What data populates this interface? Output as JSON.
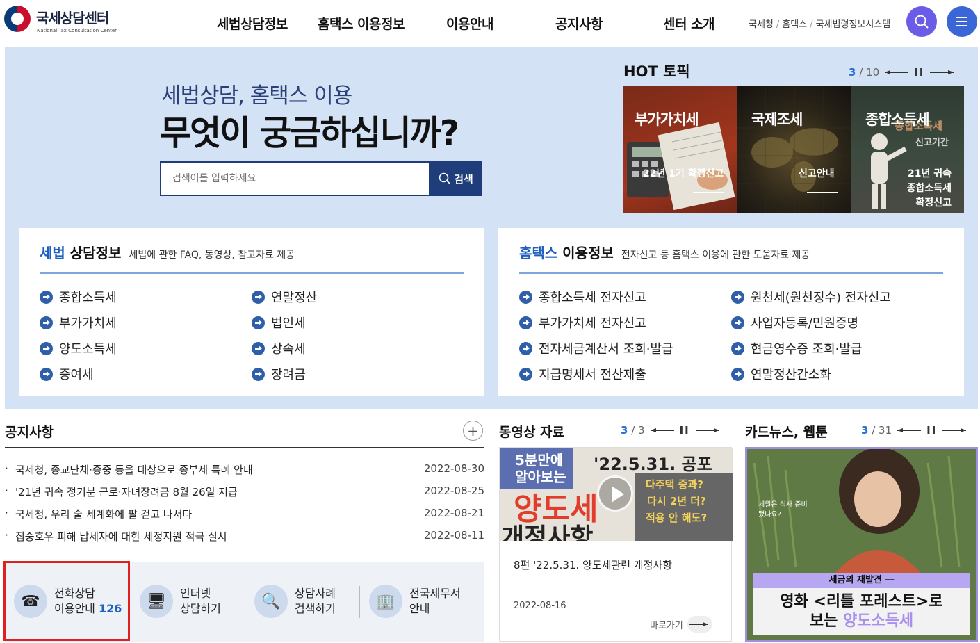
{
  "header": {
    "logo_title": "국세상담센터",
    "logo_sub": "National Tax Consultation Center",
    "nav": [
      "세법상담정보",
      "홈택스 이용정보",
      "이용안내",
      "공지사항",
      "센터 소개"
    ],
    "util_links": [
      "국세청",
      "홈택스",
      "국세법령정보시스템"
    ],
    "util_sep": "/",
    "search_icon": "search-icon",
    "menu_icon": "menu-icon",
    "colors": {
      "search_btn": "#6b5ce7",
      "menu_btn": "#3a66d8"
    }
  },
  "hero": {
    "subtitle": "세법상담, 홈택스 이용",
    "title": "무엇이 궁금하십니까?",
    "search_placeholder": "검색어를 입력하세요",
    "search_button": "검색",
    "bg_color": "#d3e2f4"
  },
  "hot_topic": {
    "title": "HOT 토픽",
    "current": "3",
    "total": "/ 10",
    "pause": "II",
    "cards": [
      {
        "title": "부가가치세",
        "sub": "22년 1기 확정신고"
      },
      {
        "title": "국제조세",
        "sub": "신고안내"
      },
      {
        "title": "종합소득세",
        "sub_lines": [
          "21년 귀속",
          "종합소득세",
          "확정신고"
        ],
        "bg_text": "종합소득세",
        "bg_text2": "신고기간"
      }
    ]
  },
  "tax_info": {
    "title_accent": "세법",
    "title_rest": " 상담정보",
    "desc": "세법에 관한 FAQ, 동영상, 참고자료 제공",
    "items": [
      "종합소득세",
      "연말정산",
      "부가가치세",
      "법인세",
      "양도소득세",
      "상속세",
      "증여세",
      "장려금"
    ]
  },
  "hometax_info": {
    "title_accent": "홈택스",
    "title_rest": " 이용정보",
    "desc": "전자신고 등 홈택스 이용에 관한 도움자료 제공",
    "items": [
      "종합소득세 전자신고",
      "원천세(원천징수) 전자신고",
      "부가가치세 전자신고",
      "사업자등록/민원증명",
      "전자세금계산서 조회·발급",
      "현금영수증 조회·발급",
      "지급명세서 전산제출",
      "연말정산간소화"
    ]
  },
  "notices": {
    "title": "공지사항",
    "more": "+",
    "bullet": "·",
    "rows": [
      {
        "title": "국세청, 종교단체·종중 등을 대상으로 종부세 특례 안내",
        "date": "2022-08-30"
      },
      {
        "title": "'21년 귀속 정기분 근로·자녀장려금 8월 26일 지급",
        "date": "2022-08-25"
      },
      {
        "title": "국세청, 우리 술 세계화에 팔 걷고 나서다",
        "date": "2022-08-21"
      },
      {
        "title": "집중호우 피해 납세자에 대한 세정지원 적극 실시",
        "date": "2022-08-11"
      }
    ]
  },
  "quick_links": [
    {
      "line1": "전화상담",
      "line2": "이용안내",
      "num": "126",
      "icon": "phone-icon",
      "glyph": "☎"
    },
    {
      "line1": "인터넷",
      "line2": "상담하기",
      "icon": "monitor-icon",
      "glyph": "🖥"
    },
    {
      "line1": "상담사례",
      "line2": "검색하기",
      "icon": "magnifier-icon",
      "glyph": "🔍"
    },
    {
      "line1": "전국세무서",
      "line2": "안내",
      "icon": "building-icon",
      "glyph": "🏢"
    }
  ],
  "videos": {
    "title": "동영상 자료",
    "current": "3",
    "total": "/ 3",
    "pause": "II",
    "thumb_text1": "5분만에",
    "thumb_text2": "알아보는",
    "thumb_text3": "양도세",
    "thumb_text4": "개정사항",
    "thumb_text5": "'22.5.31. 공포",
    "thumb_text6": "다주택 중과?",
    "thumb_text7": "다시 2년 더?",
    "thumb_text8": "적용 안 해도?",
    "item_title": "8편 '22.5.31. 양도세관련 개정사항",
    "item_date": "2022-08-16",
    "go": "바로가기"
  },
  "card_news": {
    "title": "카드뉴스, 웹툰",
    "current": "3",
    "total": "/ 31",
    "pause": "II",
    "small_text": "세월은 식사 준비 됐나요?",
    "banner": "세금의 재발견 ―",
    "headline1": "영화 <리틀 포레스트>로",
    "headline2_pre": "보는 ",
    "headline2_accent": "양도소득세"
  }
}
